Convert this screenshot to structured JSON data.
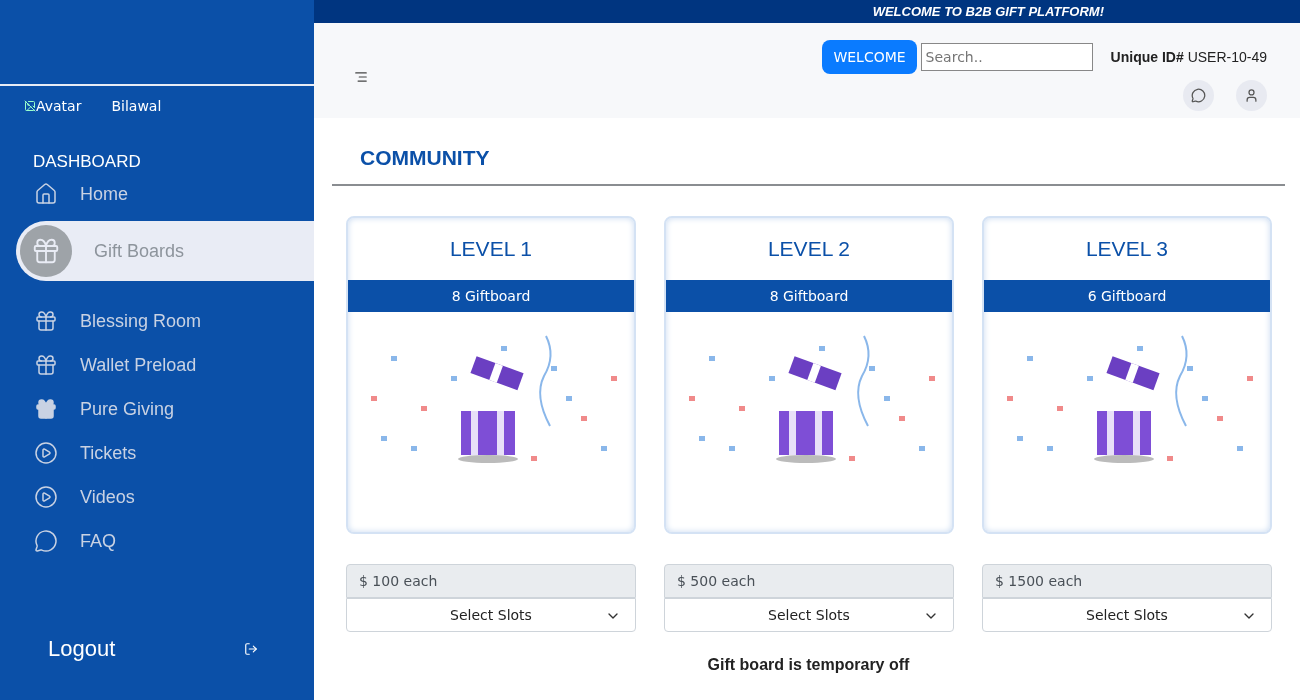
{
  "banner": "WELCOME TO B2B GIFT PLATFORM!",
  "sidebar": {
    "avatar_alt": "Avatar",
    "user_name": "Bilawal",
    "section": "DASHBOARD",
    "items": [
      {
        "label": "Home",
        "selected": false
      },
      {
        "label": "Gift Boards",
        "selected": true
      },
      {
        "label": "Blessing Room",
        "selected": false
      },
      {
        "label": "Wallet Preload",
        "selected": false
      },
      {
        "label": "Pure Giving",
        "selected": false
      },
      {
        "label": "Tickets",
        "selected": false
      },
      {
        "label": "Videos",
        "selected": false
      },
      {
        "label": "FAQ",
        "selected": false
      }
    ],
    "logout": "Logout"
  },
  "header": {
    "welcome_button": "WELCOME",
    "search": {
      "placeholder": "Search.."
    },
    "unique_id_label": "Unique ID#",
    "unique_id": "USER-10-49"
  },
  "page_title": "COMMUNITY",
  "levels": [
    {
      "title": "LEVEL 1",
      "boards": "8 Giftboard",
      "price": "$ 100 each",
      "select": "Select Slots"
    },
    {
      "title": "LEVEL 2",
      "boards": "8 Giftboard",
      "price": "$ 500 each",
      "select": "Select Slots"
    },
    {
      "title": "LEVEL 3",
      "boards": "6 Giftboard",
      "price": "$ 1500 each",
      "select": "Select Slots"
    }
  ],
  "notice": "Gift board is temporary off"
}
